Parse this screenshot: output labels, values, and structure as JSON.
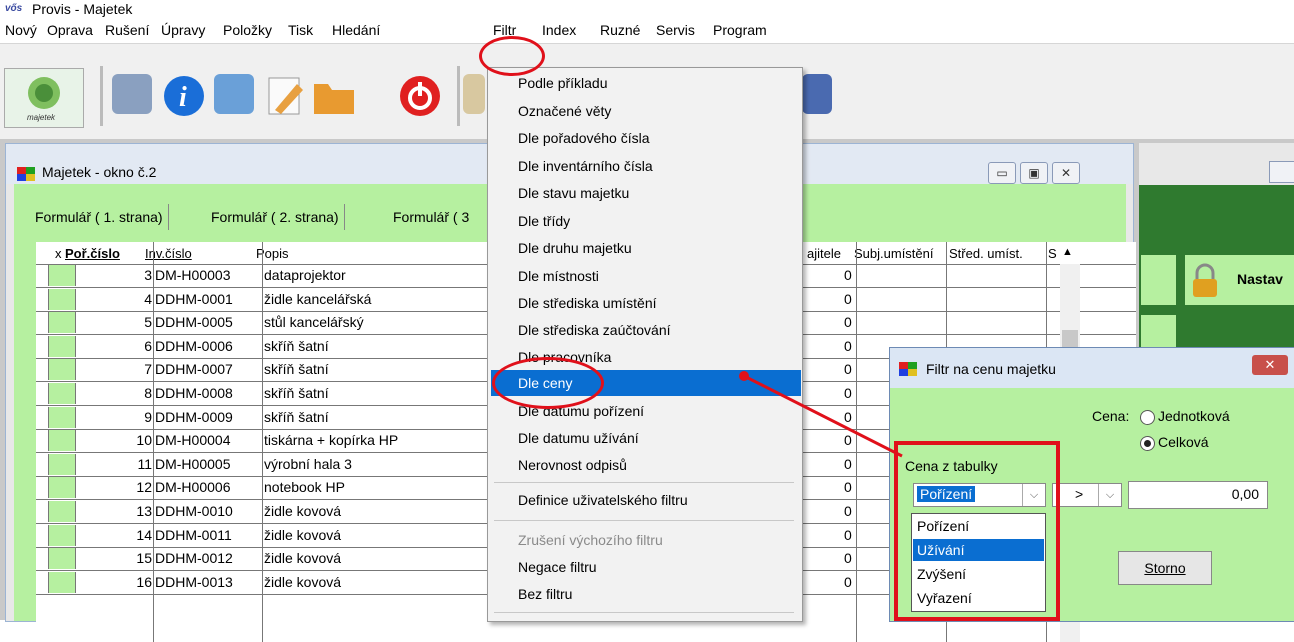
{
  "app": {
    "logo_text": "vős",
    "title": "Provis - Majetek"
  },
  "menubar": {
    "items": [
      "Nový",
      "Oprava",
      "Rušení",
      "Úpravy",
      "Položky",
      "Tisk",
      "Hledání",
      "Filtr",
      "Index",
      "Ruzné",
      "Servis",
      "Program"
    ]
  },
  "toolbar": {
    "majetek_label": "majetek"
  },
  "child_window": {
    "title": "Majetek - okno č.2",
    "tabs": [
      "Formulář ( 1. strana)",
      "Formulář ( 2. strana)",
      "Formulář ( 3"
    ],
    "columns": {
      "x": "x",
      "por_cislo": "Poř.číslo",
      "inv_cislo": "Inv.číslo",
      "popis": "Popis",
      "majitele": "ajitele",
      "subj_umisteni": "Subj.umístění",
      "stred_umist": "Střed. umíst.",
      "s": "S"
    },
    "rows": [
      {
        "num": "3",
        "inv": "DM-H00003",
        "popis": "dataprojektor",
        "val": "0"
      },
      {
        "num": "4",
        "inv": "DDHM-0001",
        "popis": "židle kancelářská",
        "val": "0"
      },
      {
        "num": "5",
        "inv": "DDHM-0005",
        "popis": "stůl kancelářský",
        "val": "0"
      },
      {
        "num": "6",
        "inv": "DDHM-0006",
        "popis": "skříň šatní",
        "val": "0"
      },
      {
        "num": "7",
        "inv": "DDHM-0007",
        "popis": "skříň šatní",
        "val": "0"
      },
      {
        "num": "8",
        "inv": "DDHM-0008",
        "popis": "skříň šatní",
        "val": "0"
      },
      {
        "num": "9",
        "inv": "DDHM-0009",
        "popis": "skříň šatní",
        "val": "0"
      },
      {
        "num": "10",
        "inv": "DM-H00004",
        "popis": "tiskárna + kopírka HP",
        "val": "0"
      },
      {
        "num": "11",
        "inv": "DM-H00005",
        "popis": "výrobní hala 3",
        "val": "0"
      },
      {
        "num": "12",
        "inv": "DM-H00006",
        "popis": "notebook HP",
        "val": "0"
      },
      {
        "num": "13",
        "inv": "DDHM-0010",
        "popis": "židle kovová",
        "val": "0"
      },
      {
        "num": "14",
        "inv": "DDHM-0011",
        "popis": "židle kovová",
        "val": "0"
      },
      {
        "num": "15",
        "inv": "DDHM-0012",
        "popis": "židle kovová",
        "val": "0"
      },
      {
        "num": "16",
        "inv": "DDHM-0013",
        "popis": "židle kovová",
        "val": "0"
      }
    ]
  },
  "right_window": {
    "label": "Nastav"
  },
  "filtr_menu": {
    "items": [
      "Podle příkladu",
      "Označené věty",
      "Dle pořadového čísla",
      "Dle inventárního čísla",
      "Dle stavu majetku",
      "Dle třídy",
      "Dle druhu majetku",
      "Dle místnosti",
      "Dle střediska umístění",
      "Dle střediska zaúčtování",
      "Dle pracovníka",
      "Dle ceny",
      "Dle datumu pořízení",
      "Dle datumu užívání",
      "Nerovnost odpisů",
      "Definice uživatelského filtru",
      "Zrušení výchozího filtru",
      "Negace filtru",
      "Bez filtru"
    ]
  },
  "dialog": {
    "title": "Filtr na cenu majetku",
    "close_label": "✕",
    "cena_label": "Cena:",
    "radio_jednotkova": "Jednotková",
    "radio_celkova": "Celková",
    "cena_z_tabulky": "Cena z tabulky",
    "combo_value": "Pořízení",
    "operator_value": ">",
    "amount_value": "0,00",
    "storno_label": "Storno",
    "options": [
      "Pořízení",
      "Užívání",
      "Zvýšení",
      "Vyřazení"
    ]
  },
  "colors": {
    "green_bg": "#b6f0a0",
    "highlight": "#0a6ed1",
    "annotation_red": "#e0101a"
  }
}
